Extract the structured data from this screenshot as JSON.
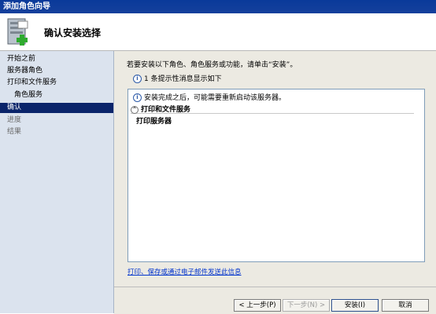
{
  "window": {
    "title": "添加角色向导"
  },
  "header": {
    "title": "确认安装选择",
    "icon": "server-add-icon"
  },
  "sidebar": {
    "items": [
      {
        "label": "开始之前",
        "state": "normal"
      },
      {
        "label": "服务器角色",
        "state": "normal"
      },
      {
        "label": "打印和文件服务",
        "state": "normal"
      },
      {
        "label": "角色服务",
        "state": "sub"
      },
      {
        "label": "确认",
        "state": "active"
      },
      {
        "label": "进度",
        "state": "disabled"
      },
      {
        "label": "结果",
        "state": "disabled"
      }
    ]
  },
  "content": {
    "instruction": "若要安装以下角色、角色服务或功能，请单击“安装”。",
    "info_count": "1 条提示性消息显示如下",
    "panel": {
      "notice": "安装完成之后，可能需要重新启动该服务器。",
      "role": "打印和文件服务",
      "service": "打印服务器"
    },
    "link": "打印、保存或通过电子邮件发送此信息"
  },
  "footer": {
    "prev": "< 上一步(P)",
    "next": "下一步(N) >",
    "install": "安装(I)",
    "cancel": "取消"
  }
}
